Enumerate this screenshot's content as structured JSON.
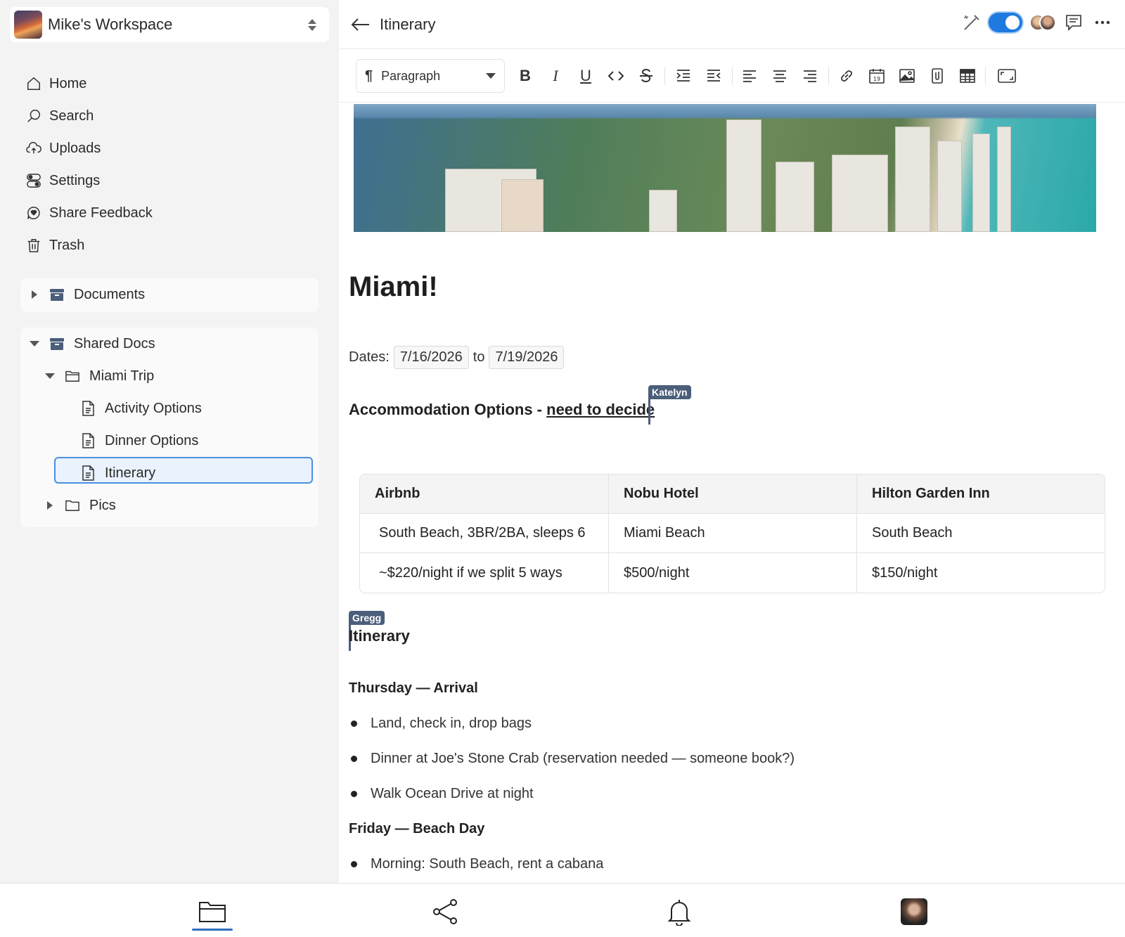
{
  "workspace": {
    "name": "Mike's Workspace"
  },
  "nav": [
    {
      "label": "Home",
      "icon": "home-icon"
    },
    {
      "label": "Search",
      "icon": "search-icon"
    },
    {
      "label": "Uploads",
      "icon": "upload-cloud-icon"
    },
    {
      "label": "Settings",
      "icon": "toggles-icon"
    },
    {
      "label": "Share Feedback",
      "icon": "feedback-bubble-icon"
    },
    {
      "label": "Trash",
      "icon": "trash-icon"
    }
  ],
  "tree": {
    "documents": "Documents",
    "shared_docs": "Shared Docs",
    "miami_trip": "Miami Trip",
    "activity_options": "Activity Options",
    "dinner_options": "Dinner Options",
    "itinerary": "Itinerary",
    "pics": "Pics"
  },
  "header": {
    "title": "Itinerary"
  },
  "toolbar": {
    "block_style": "Paragraph"
  },
  "doc": {
    "title": "Miami!",
    "dates_label": "Dates:",
    "date_start": "7/16/2026",
    "date_to": "to",
    "date_end": "7/19/2026",
    "accommodation_heading": "Accommodation Options - ",
    "accommodation_underlined": "need to decide",
    "table": {
      "headers": [
        "Airbnb",
        "Nobu Hotel",
        "Hilton Garden Inn"
      ],
      "rows": [
        [
          "South Beach, 3BR/2BA, sleeps 6",
          "Miami Beach",
          "South Beach"
        ],
        [
          "~$220/night if we split 5 ways",
          "$500/night",
          "$150/night"
        ]
      ]
    },
    "itinerary_heading": "Itinerary",
    "thursday": "Thursday — Arrival",
    "thursday_items": [
      "Land, check in, drop bags",
      "Dinner at Joe's Stone Crab (reservation needed — someone book?)",
      "Walk Ocean Drive at night"
    ],
    "friday": "Friday — Beach Day",
    "friday_items": [
      "Morning: South Beach, rent a cabana"
    ]
  },
  "collaborators": {
    "katelyn": "Katelyn",
    "gregg": "Gregg"
  },
  "colors": {
    "accent": "#1f7ae0",
    "cursor": "#4b5e7a",
    "selection": "#4a90e2"
  }
}
